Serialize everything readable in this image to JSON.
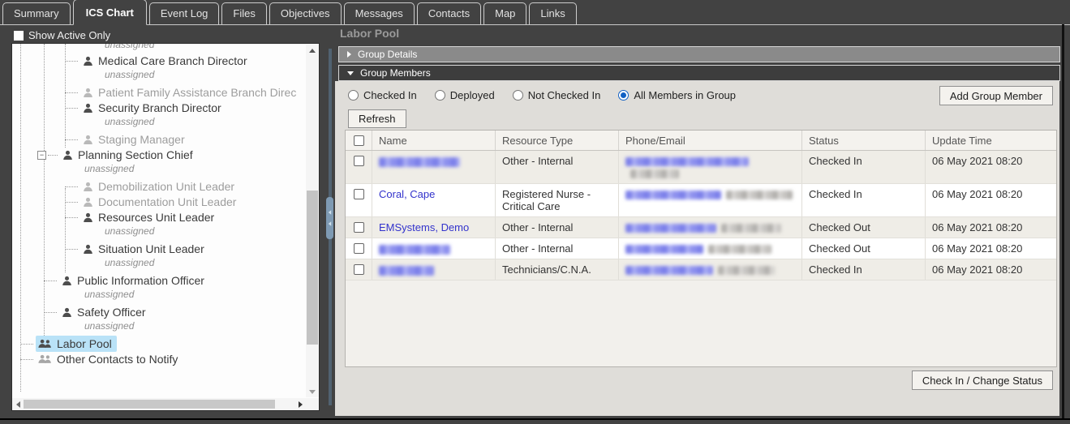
{
  "tabs": [
    {
      "label": "Summary",
      "active": false
    },
    {
      "label": "ICS Chart",
      "active": true
    },
    {
      "label": "Event Log",
      "active": false
    },
    {
      "label": "Files",
      "active": false
    },
    {
      "label": "Objectives",
      "active": false
    },
    {
      "label": "Messages",
      "active": false
    },
    {
      "label": "Contacts",
      "active": false
    },
    {
      "label": "Map",
      "active": false
    },
    {
      "label": "Links",
      "active": false
    }
  ],
  "toolbar": {
    "show_active_only": "Show Active Only",
    "checked": false
  },
  "panel": {
    "title": "Labor Pool"
  },
  "sections": {
    "group_details": "Group Details",
    "group_members": "Group Members"
  },
  "filters": [
    {
      "label": "Checked In",
      "selected": false
    },
    {
      "label": "Deployed",
      "selected": false
    },
    {
      "label": "Not Checked In",
      "selected": false
    },
    {
      "label": "All Members in Group",
      "selected": true
    }
  ],
  "buttons": {
    "add_group_member": "Add Group Member",
    "refresh": "Refresh",
    "check_in_change_status": "Check In / Change Status"
  },
  "table": {
    "columns": [
      "Name",
      "Resource Type",
      "Phone/Email",
      "Status",
      "Update Time"
    ],
    "rows": [
      {
        "name": null,
        "name_redacted_w": 100,
        "resource": "Other - Internal",
        "contact_blue_w": 152,
        "contact_gray_w": 60,
        "status": "Checked In",
        "updated": "06 May 2021 08:20"
      },
      {
        "name": "Coral, Cape",
        "resource": "Registered Nurse - Critical Care",
        "contact_blue_w": 118,
        "contact_gray_w": 82,
        "status": "Checked In",
        "updated": "06 May 2021 08:20"
      },
      {
        "name": "EMSystems, Demo",
        "resource": "Other - Internal",
        "contact_blue_w": 112,
        "contact_gray_w": 74,
        "status": "Checked Out",
        "updated": "06 May 2021 08:20"
      },
      {
        "name": null,
        "name_redacted_w": 88,
        "resource": "Other - Internal",
        "contact_blue_w": 96,
        "contact_gray_w": 78,
        "status": "Checked Out",
        "updated": "06 May 2021 08:20"
      },
      {
        "name": null,
        "name_redacted_w": 68,
        "resource": "Technicians/C.N.A.",
        "contact_blue_w": 108,
        "contact_gray_w": 70,
        "status": "Checked In",
        "updated": "06 May 2021 08:20"
      }
    ]
  },
  "tree": {
    "items": [
      {
        "sub": "unassigned",
        "level": 3,
        "partial": true
      },
      {
        "label": "Medical Care Branch Director",
        "sub": "unassigned",
        "level": 3,
        "tone": "dark",
        "icon": "person"
      },
      {
        "label": "Patient Family Assistance Branch Direc",
        "level": 3,
        "tone": "gray",
        "icon": "person"
      },
      {
        "label": "Security Branch Director",
        "sub": "unassigned",
        "level": 3,
        "tone": "dark",
        "icon": "person"
      },
      {
        "label": "Staging Manager",
        "level": 3,
        "tone": "gray",
        "icon": "person"
      },
      {
        "label": "Planning Section Chief",
        "sub": "unassigned",
        "level": 2,
        "tone": "dark",
        "icon": "person",
        "expander": "minus"
      },
      {
        "label": "Demobilization Unit Leader",
        "level": 3,
        "tone": "gray",
        "icon": "person"
      },
      {
        "label": "Documentation Unit Leader",
        "level": 3,
        "tone": "gray",
        "icon": "person"
      },
      {
        "label": "Resources Unit Leader",
        "sub": "unassigned",
        "level": 3,
        "tone": "dark",
        "icon": "person"
      },
      {
        "label": "Situation Unit Leader",
        "sub": "unassigned",
        "level": 3,
        "tone": "dark",
        "icon": "person"
      },
      {
        "label": "Public Information Officer",
        "sub": "unassigned",
        "level": 2,
        "tone": "dark",
        "icon": "person"
      },
      {
        "label": "Safety Officer",
        "sub": "unassigned",
        "level": 2,
        "tone": "dark",
        "icon": "person"
      },
      {
        "label": "Labor Pool",
        "level": 1,
        "tone": "dark",
        "icon": "group",
        "selected": true
      },
      {
        "label": "Other Contacts to Notify",
        "level": 1,
        "tone": "dark",
        "icon": "groupgray"
      }
    ]
  },
  "colors": {
    "link": "#3333cc",
    "tree_selection": "#b9e2f7",
    "radio_accent": "#1160c4"
  }
}
